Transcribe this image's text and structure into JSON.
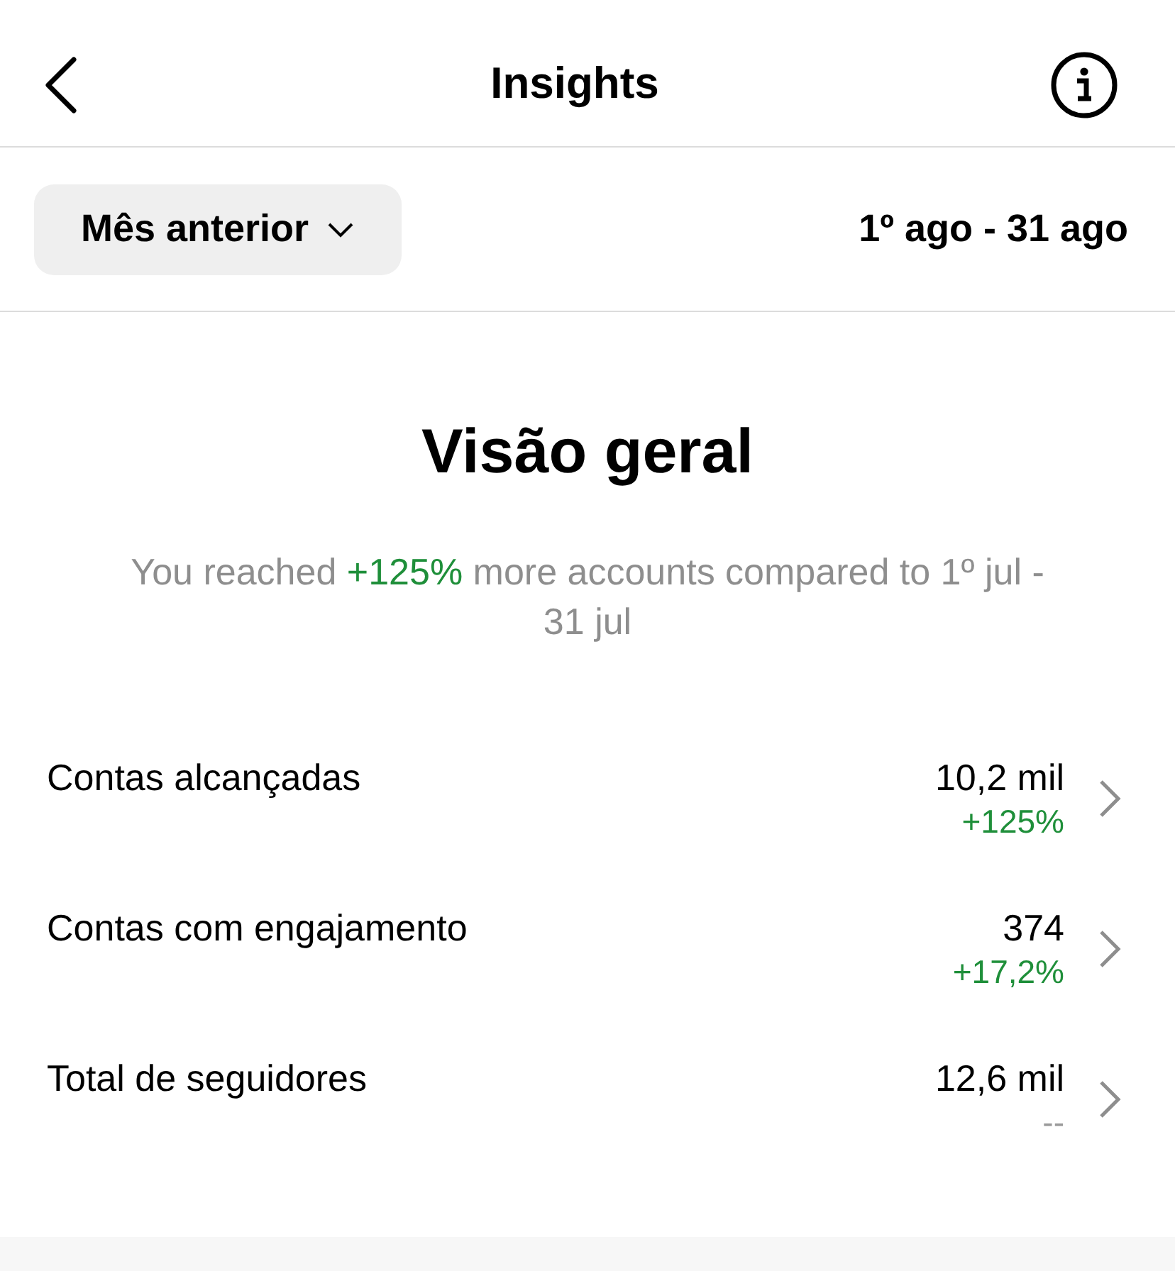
{
  "header": {
    "title": "Insights"
  },
  "filter": {
    "label": "Mês anterior",
    "date_range": "1º ago - 31 ago"
  },
  "overview": {
    "title": "Visão geral",
    "summary": {
      "before": "You reached ",
      "highlight": "+125%",
      "after": " more accounts compared to 1º jul - 31 jul"
    }
  },
  "metrics": [
    {
      "label": "Contas alcançadas",
      "value": "10,2 mil",
      "change": "+125%",
      "kind": "up"
    },
    {
      "label": "Contas com engajamento",
      "value": "374",
      "change": "+17,2%",
      "kind": "up"
    },
    {
      "label": "Total de seguidores",
      "value": "12,6 mil",
      "change": "--",
      "kind": "none"
    }
  ]
}
